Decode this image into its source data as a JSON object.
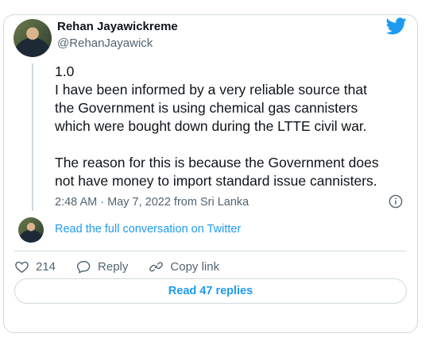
{
  "author": {
    "name": "Rehan Jayawickreme",
    "handle": "@RehanJayawick"
  },
  "tweet": {
    "text": "1.0\nI have been informed by a very reliable source that\nthe Government is using chemical gas cannisters\nwhich were bought down during the LTTE civil war.\n\nThe reason for this is because the Government does\nnot have money to import standard issue cannisters.",
    "meta": "2:48 AM · May 7, 2022 from Sri Lanka"
  },
  "thread": {
    "read_conversation": "Read the full conversation on Twitter"
  },
  "actions": {
    "like_count": "214",
    "reply_label": "Reply",
    "copy_label": "Copy link"
  },
  "replies_button": "Read 47 replies",
  "icons": {
    "brand": "twitter-bird-icon",
    "info": "info-icon",
    "like": "heart-icon",
    "reply": "speech-bubble-icon",
    "copy": "link-icon"
  },
  "colors": {
    "accent": "#1d9bf0",
    "text": "#0f1419",
    "secondary": "#536471",
    "border": "#cfd9de"
  }
}
